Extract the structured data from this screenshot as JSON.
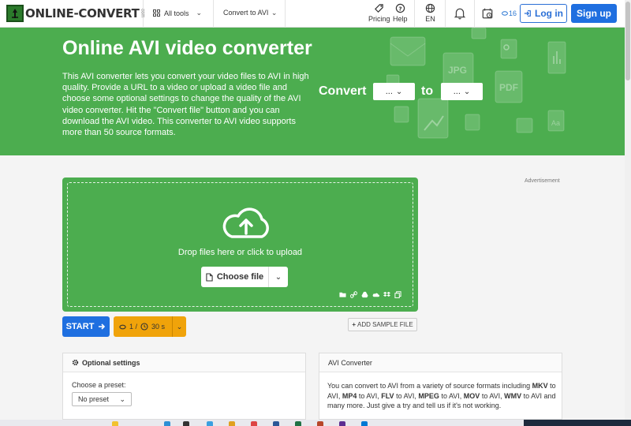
{
  "header": {
    "logo_text": "ONLINE-CONVERT",
    "logo_suffix": "com",
    "all_tools": "All tools",
    "convert_to": "Convert to AVI",
    "pricing": "Pricing",
    "help": "Help",
    "language": "EN",
    "credits": "16",
    "login": "Log in",
    "signup": "Sign up"
  },
  "hero": {
    "title": "Online AVI video converter",
    "description": "This AVI converter lets you convert your video files to AVI in high quality. Provide a URL to a video or upload a video file and choose some optional settings to change the quality of the AVI video converter. Hit the \"Convert file\" button and you can download the AVI video. This converter to AVI video supports more than 50 source formats.",
    "convert_label": "Convert",
    "from_value": "...",
    "to_label": "to",
    "to_value": "...",
    "deco_labels": [
      "JPG",
      "PDF",
      "Aa"
    ]
  },
  "upload": {
    "drop_text": "Drop files here or click to upload",
    "choose_file": "Choose file"
  },
  "actions": {
    "start": "START",
    "timer_count": "1 /",
    "timer_seconds": "30 s",
    "add_sample": "ADD SAMPLE FILE"
  },
  "advertisement": "Advertisement",
  "optional_settings": {
    "title": "Optional settings",
    "preset_label": "Choose a preset:",
    "preset_value": "No preset"
  },
  "avi_converter": {
    "title": "AVI Converter",
    "text_1": "You can convert to AVI from a variety of source formats including ",
    "mkv": "MKV",
    "text_2": " to AVI, ",
    "mp4": "MP4",
    "text_3": " to AVI, ",
    "flv": "FLV",
    "text_4": " to AVI, ",
    "mpeg": "MPEG",
    "text_5": " to AVI, ",
    "mov": "MOV",
    "text_6": " to AVI, ",
    "wmv": "WMV",
    "text_7": " to AVI and many more. Just give a try and tell us if it's not working."
  },
  "colors": {
    "brand_green": "#4cad4f",
    "primary_blue": "#1f6fe0",
    "timer_orange": "#f0a30a"
  }
}
